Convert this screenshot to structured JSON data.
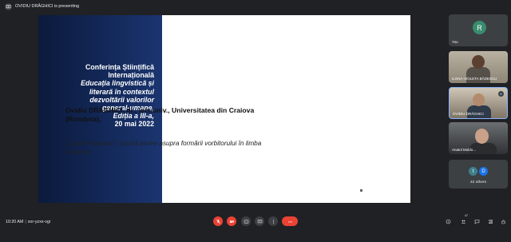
{
  "app": {
    "presenter_banner": "OVIDIU DRĂGHICI is presenting"
  },
  "slide": {
    "conference": [
      {
        "text": "Conferința Științifică",
        "italic": false
      },
      {
        "text": "Internațională",
        "italic": false
      },
      {
        "text": "Educația lingvistică și",
        "italic": true
      },
      {
        "text": "literară în contextul",
        "italic": true
      },
      {
        "text": "dezvoltării valorilor",
        "italic": true
      },
      {
        "text": "general-umane,",
        "italic": true
      },
      {
        "text": "Ediția a III-a,",
        "italic": true
      },
      {
        "text": "20 mai 2022",
        "italic": false
      }
    ],
    "author": "Ovidiu DRĂGHICI, dr., lect.univ., Universitatea din Craiova (România),",
    "subtitle": "„Copiii limbajului”. Scurtă privire asupra formării vorbitorului în limba maternă."
  },
  "participants": {
    "you": {
      "initial": "R",
      "name": "You",
      "avatar_color": "#3a8c6e"
    },
    "violeta": {
      "name": "ILONA-VIOLETA BĂDESCU"
    },
    "ovidiu": {
      "name": "OVIDIU DRĂGHICI"
    },
    "anatol": {
      "name": "Anatol Moldo..."
    },
    "others": {
      "initials": [
        "t",
        "D"
      ],
      "colors": [
        "#3f7f8c",
        "#1a73e8"
      ],
      "label": "42 others"
    }
  },
  "bottom": {
    "time": "10:20 AM",
    "meeting_code": "xor-yzxx-vgi",
    "badge_count": "47"
  },
  "colors": {
    "background": "#202124",
    "control_red": "#ea4335",
    "control_grey": "#3c4043"
  }
}
